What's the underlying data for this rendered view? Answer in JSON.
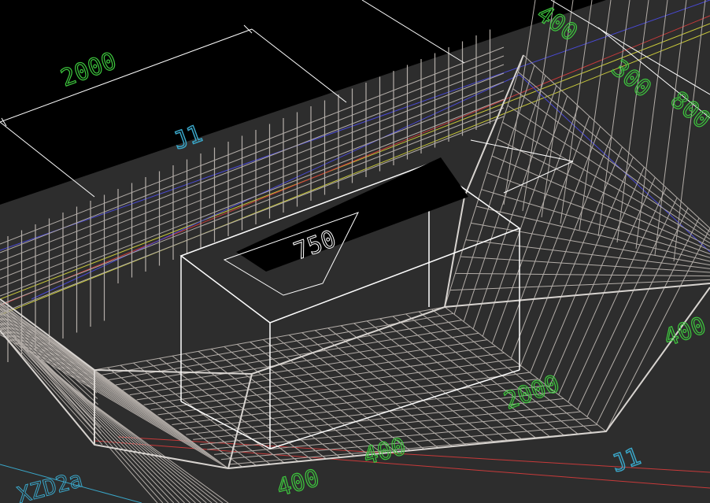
{
  "view": {
    "name": "cad-3d-wireframe-viewport"
  },
  "colors": {
    "background_top": "#000000",
    "background_floor": "#2d2d2d",
    "rebar": "#b3ada8",
    "frame": "#ffffff",
    "dim_text": "#3ec93e",
    "axis_cyan": "#3aa6c8",
    "blue_line": "#4a4ad8",
    "yellow_line": "#c8c83a",
    "red_line": "#c83a3a"
  },
  "dimensions": {
    "dim_2000_top": "2000",
    "dim_400_a": "400",
    "dim_300": "300",
    "dim_800": "800",
    "dim_750": "750",
    "dim_2000_floor": "2000",
    "dim_400_b": "400",
    "dim_400_c": "400",
    "dim_400_d": "400"
  },
  "labels": {
    "axis_j1_top": "J1",
    "axis_j1_bottom": "J1",
    "element_tag": "XZD2a"
  }
}
